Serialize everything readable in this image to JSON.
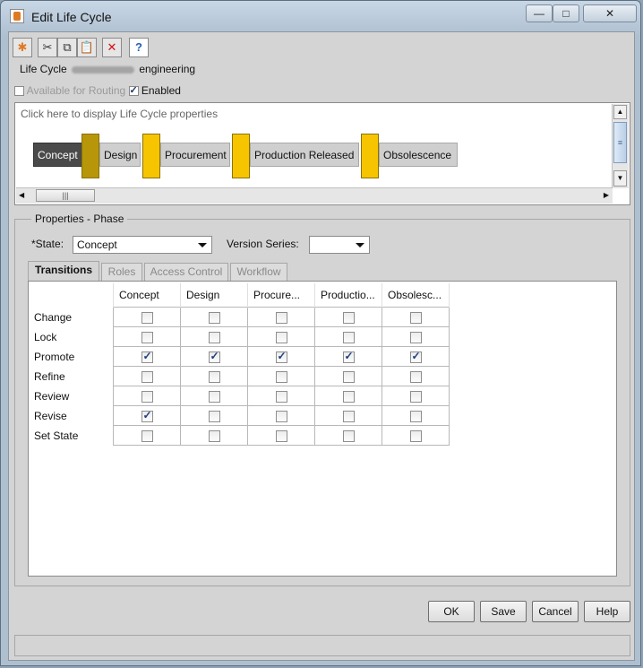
{
  "window": {
    "title": "Edit Life Cycle",
    "minimize_glyph": "—",
    "maximize_glyph": "□",
    "close_glyph": "✕"
  },
  "toolbar": [
    {
      "name": "new-icon",
      "glyph": "✱",
      "color": "#e07a22"
    },
    {
      "name": "cut-icon",
      "glyph": "✂",
      "color": "#333333"
    },
    {
      "name": "copy-icon",
      "glyph": "⧉",
      "color": "#333333"
    },
    {
      "name": "paste-icon",
      "glyph": "📋",
      "color": "#333333"
    },
    {
      "name": "delete-icon",
      "glyph": "✕",
      "color": "#d21010"
    },
    {
      "name": "help-icon",
      "glyph": "?",
      "color": "#2460b8"
    }
  ],
  "life_cycle": {
    "label": "Life Cycle",
    "name_suffix": "engineering"
  },
  "options": {
    "available_for_routing": {
      "label": "Available for Routing",
      "checked": false,
      "enabled": false
    },
    "enabled": {
      "label": "Enabled",
      "checked": true
    }
  },
  "lifecycle_area": {
    "hint": "Click here to display Life Cycle properties",
    "phases": [
      {
        "label": "Concept",
        "selected": true
      },
      {
        "label": "Design",
        "selected": false
      },
      {
        "label": "Procurement",
        "selected": false
      },
      {
        "label": "Production Released",
        "selected": false
      },
      {
        "label": "Obsolescence",
        "selected": false
      }
    ],
    "gate_color": "#f7c400",
    "gate_selected_color": "#b8960a"
  },
  "properties": {
    "legend": "Properties - Phase",
    "state_label": "*State:",
    "state_value": "Concept",
    "version_label": "Version Series:",
    "version_value": ""
  },
  "tabs": [
    {
      "label": "Transitions",
      "active": true
    },
    {
      "label": "Roles",
      "active": false
    },
    {
      "label": "Access Control",
      "active": false
    },
    {
      "label": "Workflow",
      "active": false
    }
  ],
  "transitions": {
    "columns": [
      "Concept",
      "Design",
      "Procure...",
      "Productio...",
      "Obsolesc..."
    ],
    "rows": [
      {
        "label": "Change",
        "checks": [
          false,
          false,
          false,
          false,
          false
        ]
      },
      {
        "label": "Lock",
        "checks": [
          false,
          false,
          false,
          false,
          false
        ]
      },
      {
        "label": "Promote",
        "checks": [
          true,
          true,
          true,
          true,
          true
        ]
      },
      {
        "label": "Refine",
        "checks": [
          false,
          false,
          false,
          false,
          false
        ]
      },
      {
        "label": "Review",
        "checks": [
          false,
          false,
          false,
          false,
          false
        ]
      },
      {
        "label": "Revise",
        "checks": [
          true,
          false,
          false,
          false,
          false
        ]
      },
      {
        "label": "Set State",
        "checks": [
          false,
          false,
          false,
          false,
          false
        ]
      }
    ]
  },
  "buttons": {
    "ok": "OK",
    "save": "Save",
    "cancel": "Cancel",
    "help": "Help"
  }
}
